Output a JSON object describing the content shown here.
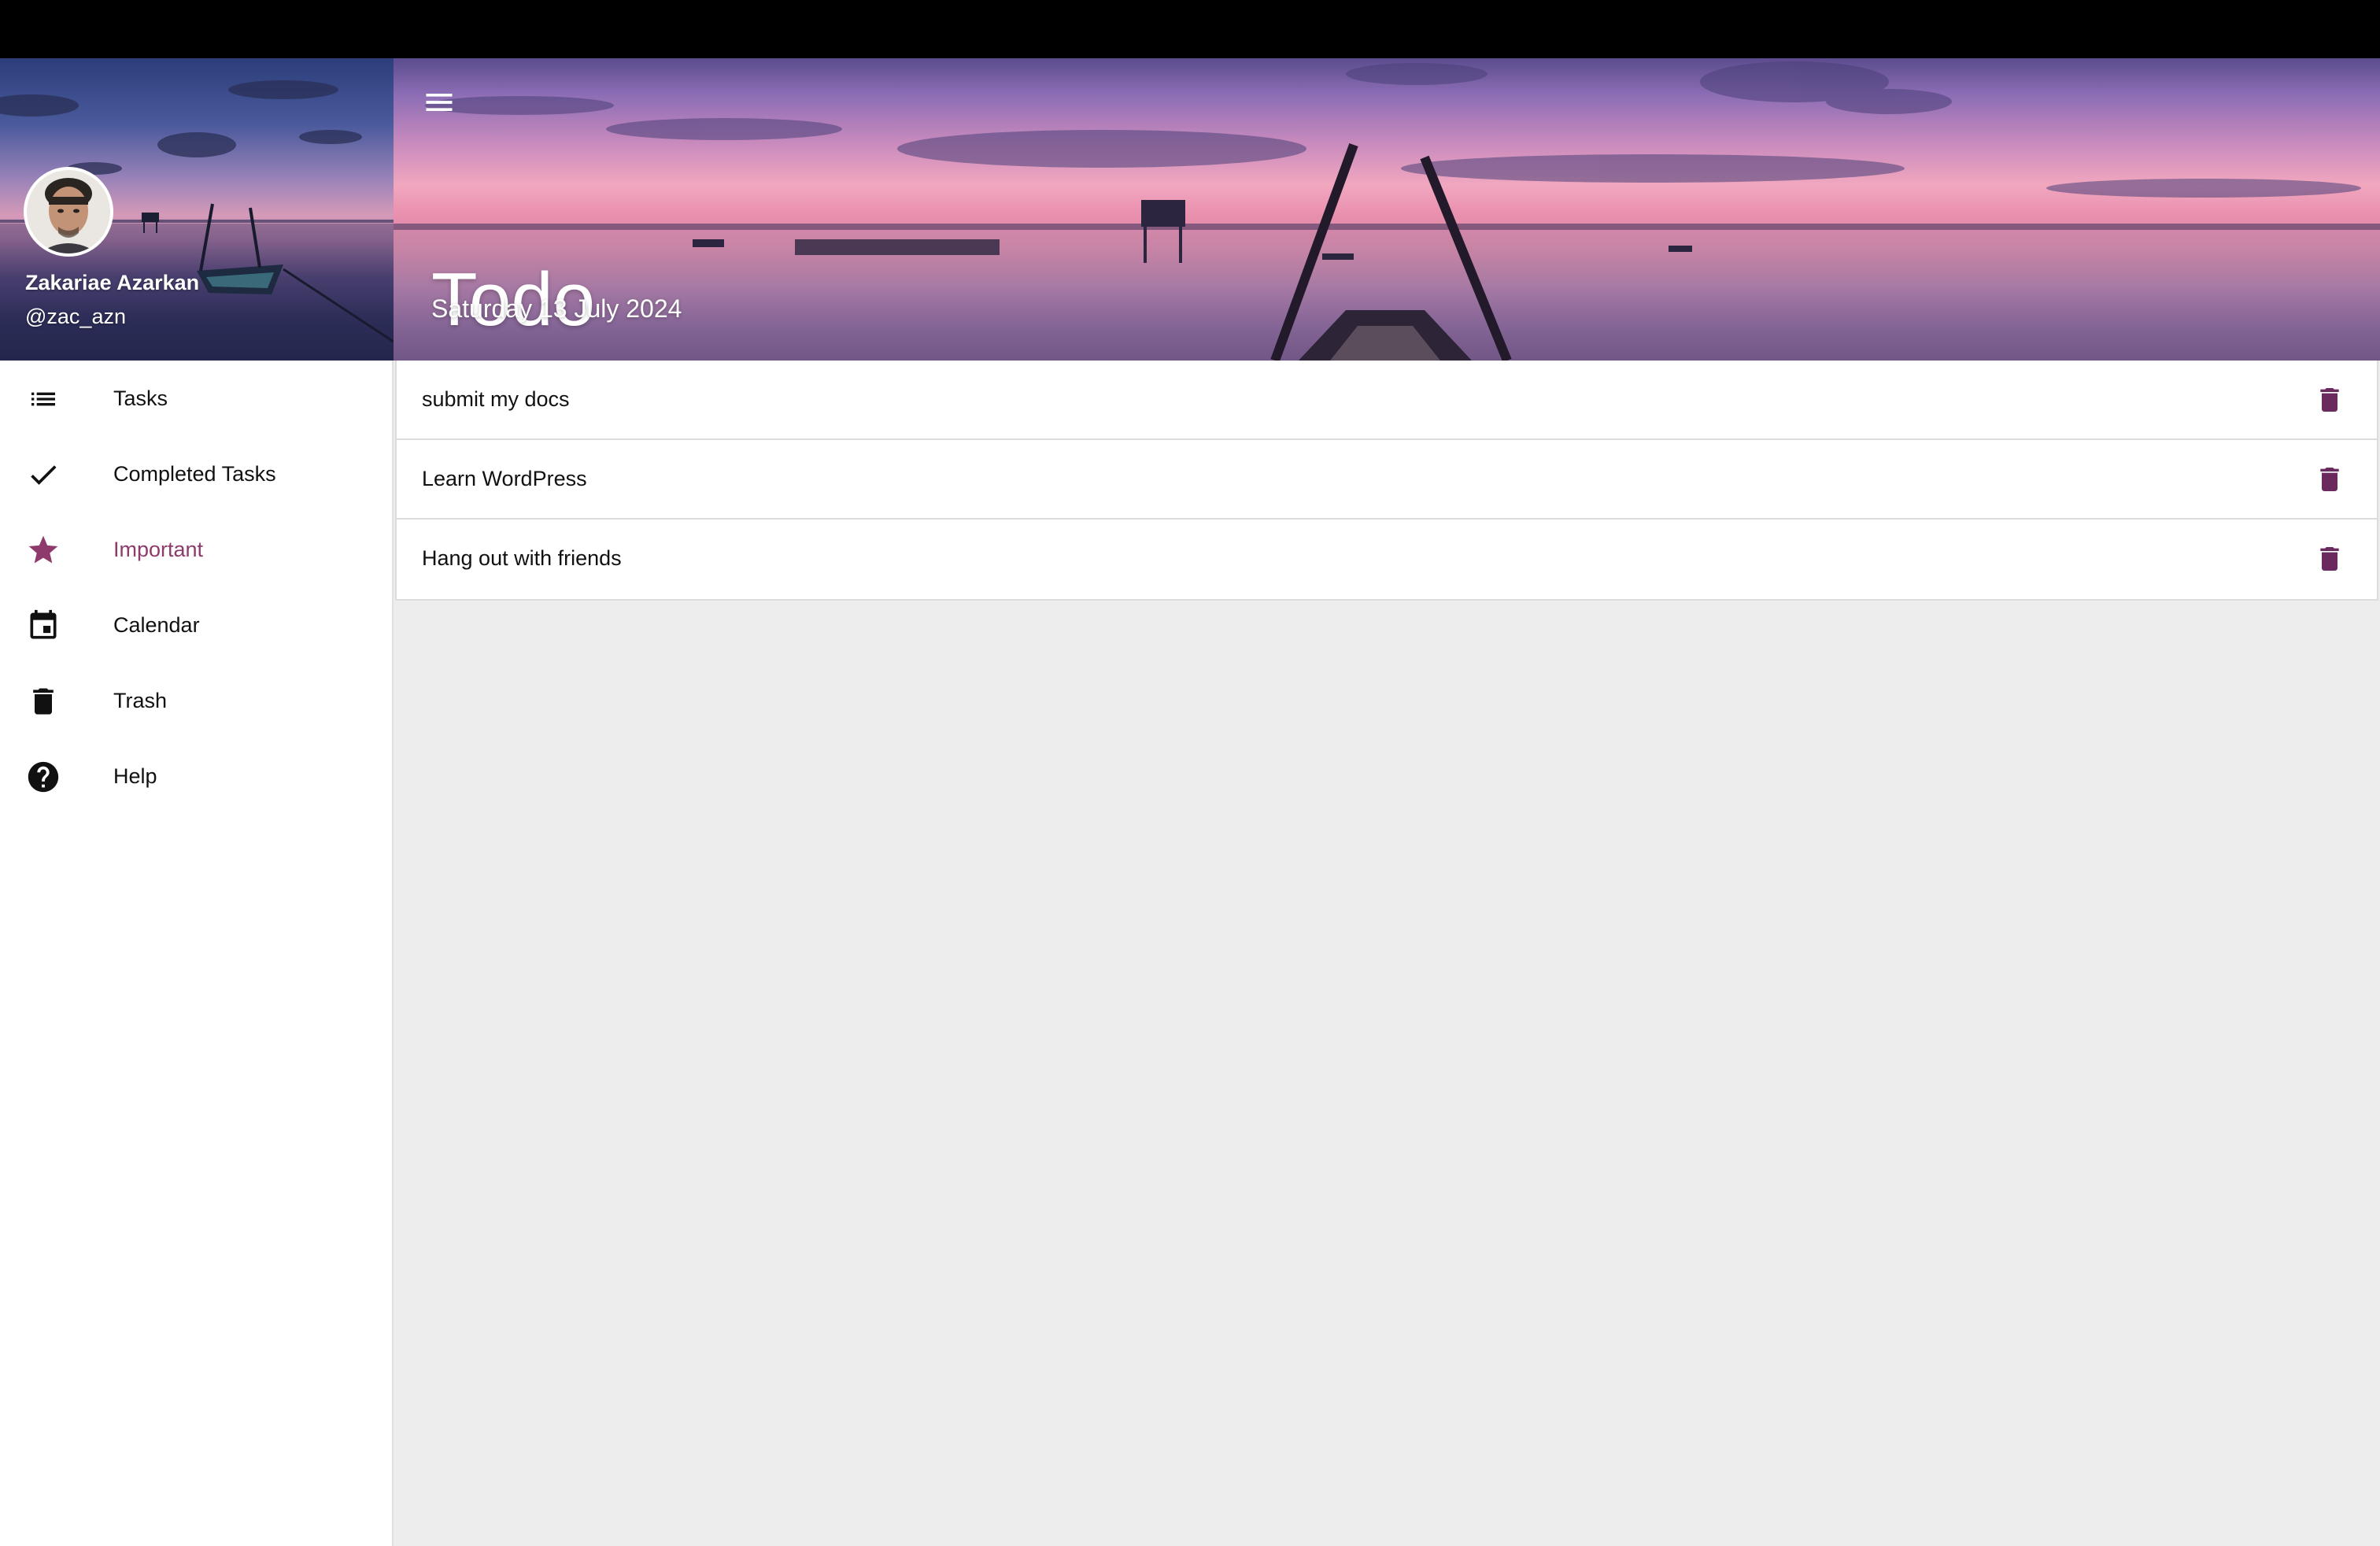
{
  "theme": {
    "accent": "#8f3a6c",
    "delete_icon_color": "#6a2a5e",
    "content_bg": "#ededed"
  },
  "sidebar": {
    "user": {
      "name": "Zakariae Azarkan",
      "handle": "@zac_azn"
    },
    "items": [
      {
        "label": "Tasks",
        "icon": "list-icon",
        "active": false
      },
      {
        "label": "Completed Tasks",
        "icon": "check-icon",
        "active": false
      },
      {
        "label": "Important",
        "icon": "star-icon",
        "active": true
      },
      {
        "label": "Calendar",
        "icon": "calendar-icon",
        "active": false
      },
      {
        "label": "Trash",
        "icon": "trash-icon",
        "active": false
      },
      {
        "label": "Help",
        "icon": "help-icon",
        "active": false
      }
    ]
  },
  "header": {
    "title": "Todo",
    "date": "Saturday 13 July 2024",
    "menu_icon": "menu-icon"
  },
  "tasks": [
    {
      "text": "submit my docs",
      "action_icon": "trash-icon"
    },
    {
      "text": "Learn WordPress",
      "action_icon": "trash-icon"
    },
    {
      "text": "Hang out with friends",
      "action_icon": "trash-icon"
    }
  ]
}
